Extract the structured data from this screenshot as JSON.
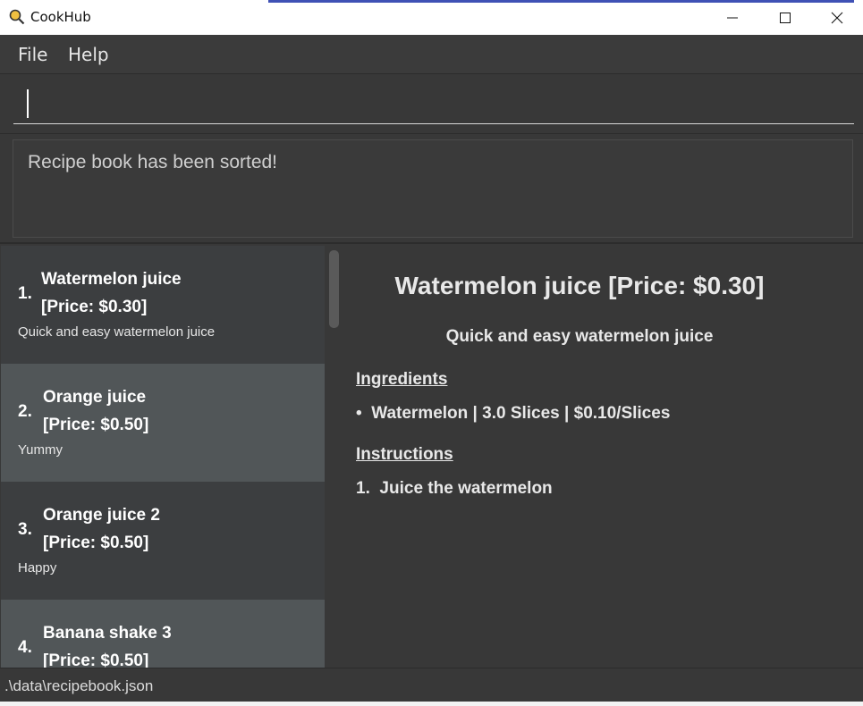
{
  "window": {
    "title": "CookHub",
    "app_icon": "magnifier-icon",
    "minimize_icon": "minimize-icon",
    "maximize_icon": "maximize-icon",
    "close_icon": "close-icon"
  },
  "menu": {
    "items": [
      {
        "label": "File"
      },
      {
        "label": "Help"
      }
    ]
  },
  "command": {
    "value": "",
    "placeholder": ""
  },
  "result": {
    "message": "Recipe book has been sorted!"
  },
  "recipes": [
    {
      "index": "1.",
      "name": "Watermelon juice",
      "price": "[Price: $0.30]",
      "description": "Quick and easy watermelon juice"
    },
    {
      "index": "2.",
      "name": "Orange juice",
      "price": "[Price: $0.50]",
      "description": "Yummy"
    },
    {
      "index": "3.",
      "name": "Orange juice 2",
      "price": "[Price: $0.50]",
      "description": "Happy"
    },
    {
      "index": "4.",
      "name": "Banana shake 3",
      "price": "[Price: $0.50]",
      "description": ""
    }
  ],
  "detail": {
    "title": "Watermelon juice [Price: $0.30]",
    "description": "Quick and easy watermelon juice",
    "ingredients_heading": "Ingredients",
    "ingredients": [
      {
        "bullet": "•",
        "text": "Watermelon | 3.0 Slices | $0.10/Slices"
      }
    ],
    "instructions_heading": "Instructions",
    "instructions": [
      {
        "number": "1.",
        "text": "Juice the watermelon"
      }
    ]
  },
  "status": {
    "path": ".\\data\\recipebook.json"
  },
  "colors": {
    "background": "#383838",
    "card_odd": "#3c3e40",
    "card_even": "#515658",
    "text": "#e8e8e8"
  }
}
